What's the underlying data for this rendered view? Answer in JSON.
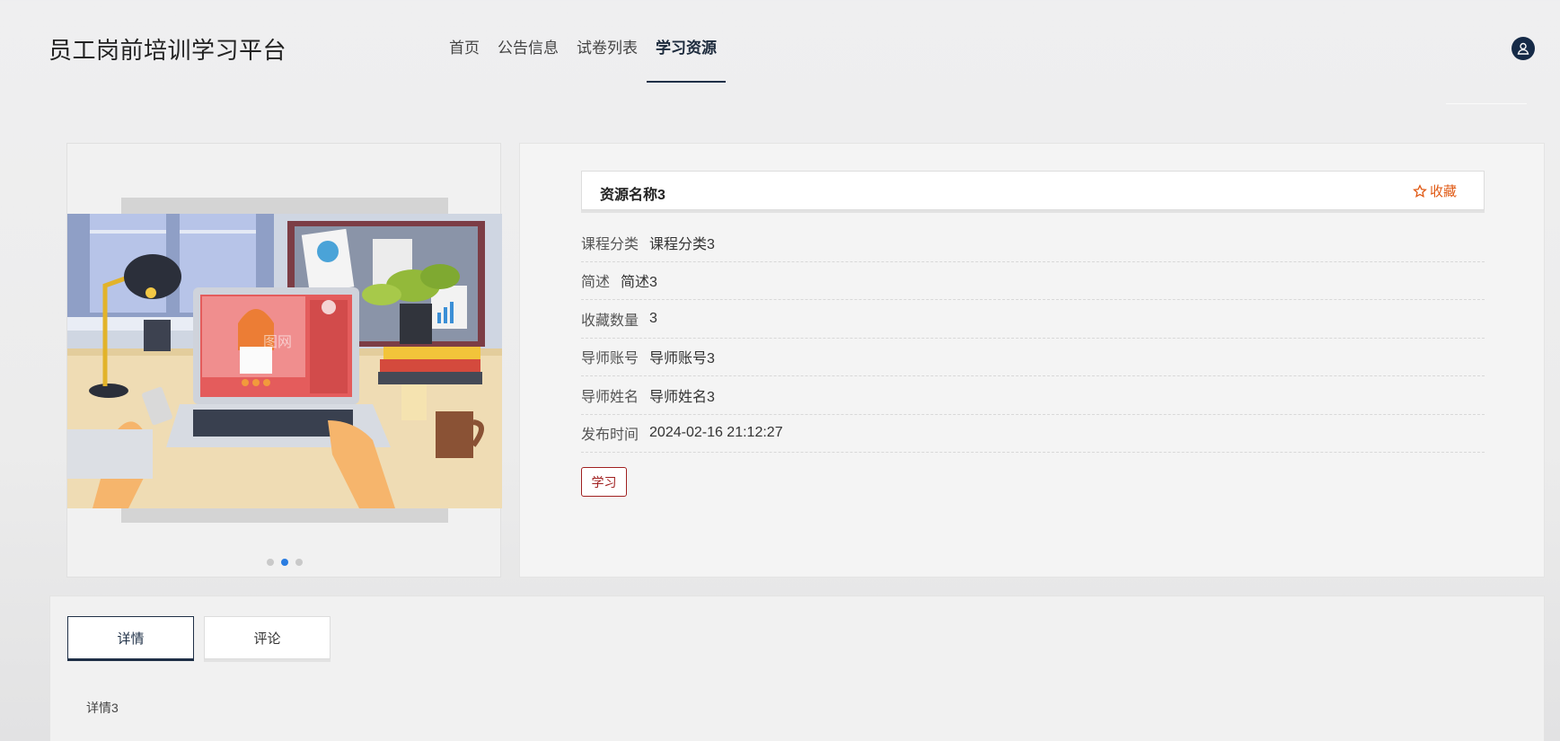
{
  "header": {
    "logo": "员工岗前培训学习平台",
    "nav": [
      {
        "label": "首页"
      },
      {
        "label": "公告信息"
      },
      {
        "label": "试卷列表"
      },
      {
        "label": "学习资源",
        "active": true
      }
    ]
  },
  "carousel": {
    "dots": 3,
    "active_dot": 2,
    "watermark": "图网"
  },
  "resource": {
    "name": "资源名称3",
    "favorite_label": "收藏",
    "fields": [
      {
        "label": "课程分类",
        "value": "课程分类3"
      },
      {
        "label": "简述",
        "value": "简述3"
      },
      {
        "label": "收藏数量",
        "value": "3"
      },
      {
        "label": "导师账号",
        "value": "导师账号3"
      },
      {
        "label": "导师姓名",
        "value": "导师姓名3"
      },
      {
        "label": "发布时间",
        "value": "2024-02-16 21:12:27"
      }
    ],
    "learn_label": "学习"
  },
  "tabs": [
    {
      "label": "详情",
      "active": true
    },
    {
      "label": "评论"
    }
  ],
  "detail_text": "详情3",
  "colors": {
    "accent": "#1f3047",
    "favorite": "#e05a15",
    "learn_button": "#a02020",
    "active_dot": "#2a7de1"
  }
}
